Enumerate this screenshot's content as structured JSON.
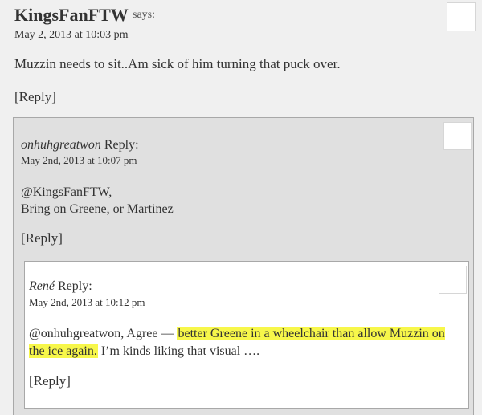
{
  "comment1": {
    "author": "KingsFanFTW",
    "says": "says:",
    "date": "May 2, 2013 at 10:03 pm",
    "body": "Muzzin needs to sit..Am sick of him turning that puck over.",
    "reply_label": "[Reply]"
  },
  "comment2": {
    "author": "onhuhgreatwon",
    "reply_word": "Reply:",
    "date": "May 2nd, 2013 at 10:07 pm",
    "body_line1": "@KingsFanFTW,",
    "body_line2": "Bring on Greene, or Martinez",
    "reply_label": "[Reply]"
  },
  "comment3": {
    "author": "René",
    "reply_word": "Reply:",
    "date": "May 2nd, 2013 at 10:12 pm",
    "body_prefix": "@onhuhgreatwon, Agree — ",
    "body_highlight": "better Greene in a wheelchair than allow Muzzin on the ice again.",
    "body_suffix": " I’m kinds liking that visual ….",
    "reply_label": "[Reply]"
  },
  "colors": {
    "highlight": "#f7f74a",
    "page_bg": "#f0f0f0",
    "nested_bg": "#e0e0e0"
  }
}
